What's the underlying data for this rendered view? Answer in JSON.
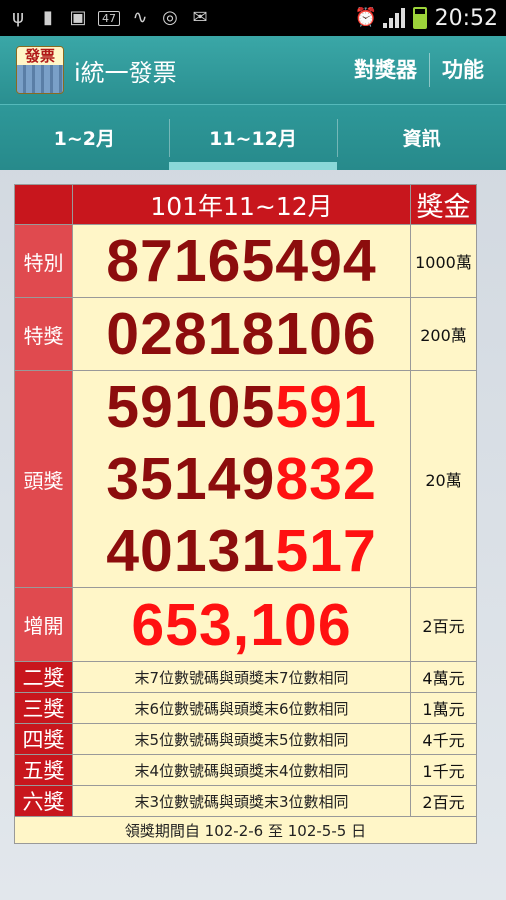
{
  "status_bar": {
    "notification_badge": "47",
    "time": "20:52",
    "icons": [
      "usb-icon",
      "sd-card-icon",
      "image-icon",
      "badge-icon",
      "signal-app-icon",
      "sync-icon",
      "mail-icon",
      "alarm-icon",
      "signal-icon",
      "battery-icon"
    ]
  },
  "app_bar": {
    "logo_text": "發票",
    "title": "i統一發票",
    "actions": {
      "checker": "對獎器",
      "menu": "功能"
    }
  },
  "tabs": [
    {
      "label": "1~2月",
      "active": false
    },
    {
      "label": "11~12月",
      "active": true
    },
    {
      "label": "資訊",
      "active": false
    }
  ],
  "table": {
    "period": "101年11~12月",
    "amount_header": "獎金",
    "special_prize": {
      "label": "特別",
      "number": "87165494",
      "amount": "1000萬"
    },
    "grand_prize": {
      "label": "特獎",
      "number": "02818106",
      "amount": "200萬"
    },
    "first_prize": {
      "label": "頭獎",
      "amount": "20萬",
      "numbers": [
        {
          "prefix": "59105",
          "suffix": "591"
        },
        {
          "prefix": "35149",
          "suffix": "832"
        },
        {
          "prefix": "40131",
          "suffix": "517"
        }
      ]
    },
    "additional_prize": {
      "label": "增開",
      "number": "653,106",
      "amount": "2百元"
    },
    "minor_prizes": [
      {
        "label": "二獎",
        "rule": "末7位數號碼與頭獎末7位數相同",
        "amount": "4萬元"
      },
      {
        "label": "三獎",
        "rule": "末6位數號碼與頭獎末6位數相同",
        "amount": "1萬元"
      },
      {
        "label": "四獎",
        "rule": "末5位數號碼與頭獎末5位數相同",
        "amount": "4千元"
      },
      {
        "label": "五獎",
        "rule": "末4位數號碼與頭獎末4位數相同",
        "amount": "1千元"
      },
      {
        "label": "六獎",
        "rule": "末3位數號碼與頭獎末3位數相同",
        "amount": "2百元"
      }
    ],
    "claim_period": "領獎期間自 102-2-6 至 102-5-5 日"
  },
  "colors": {
    "header_red": "#c8161d",
    "label_red": "#e04a4f",
    "cell_cream": "#fff6c8",
    "number_dark_red": "#8c0d0d",
    "number_bright_red": "#ff1111",
    "bar_teal": "#2a8f90"
  }
}
